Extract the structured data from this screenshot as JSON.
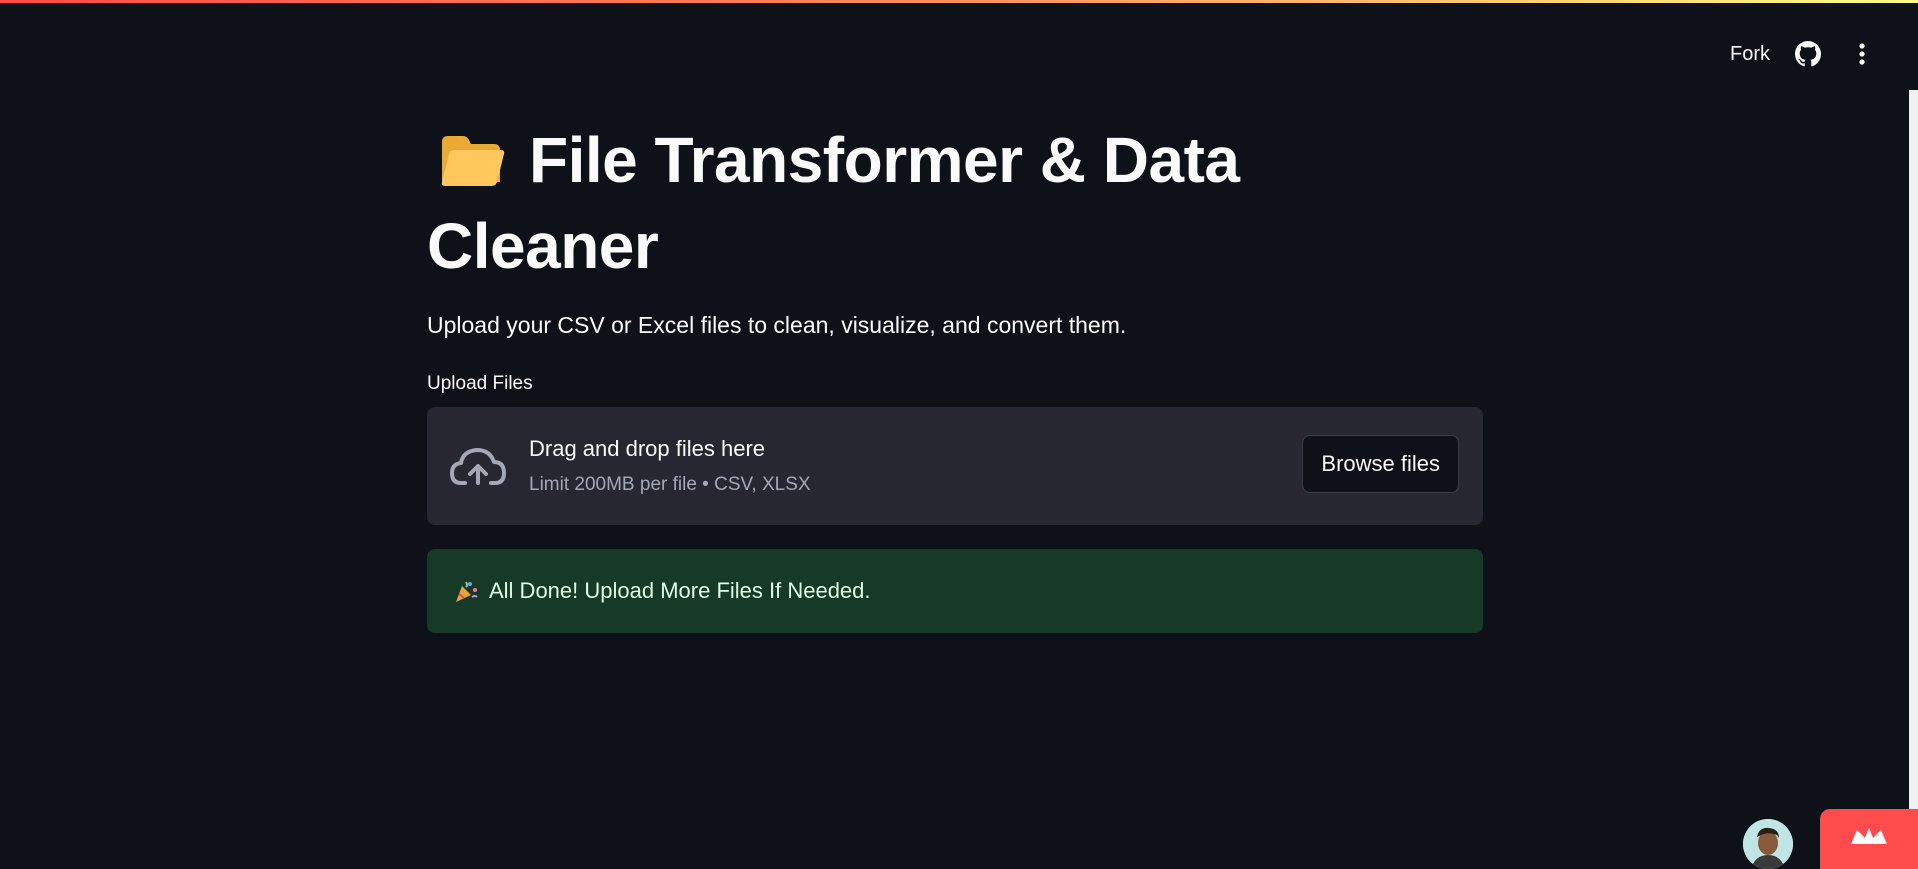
{
  "header": {
    "fork_label": "Fork",
    "github_icon": "github-icon",
    "menu_icon": "more-vertical-icon"
  },
  "main": {
    "title_icon": "open-folder-icon",
    "title": "File Transformer & Data Cleaner",
    "subtitle": "Upload your CSV or Excel files to clean, visualize, and convert them.",
    "uploader": {
      "label": "Upload Files",
      "icon": "cloud-upload-icon",
      "drop_text": "Drag and drop files here",
      "limit_text": "Limit 200MB per file • CSV, XLSX",
      "browse_label": "Browse files"
    },
    "success": {
      "icon": "party-popper-icon",
      "message": "All Done! Upload More Files If Needed."
    }
  },
  "footer": {
    "avatar_icon": "user-avatar",
    "badge_icon": "streamlit-crown-icon"
  },
  "colors": {
    "background": "#0e1117",
    "surface": "#262730",
    "success_bg": "#173928",
    "accent": "#ff4b4b"
  }
}
